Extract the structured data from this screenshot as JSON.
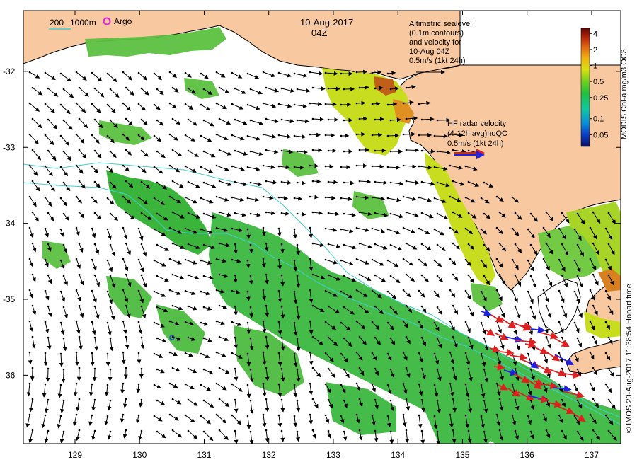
{
  "title": {
    "date": "10-Aug-2017",
    "time": "04Z"
  },
  "scale_legend": {
    "contour_200": "200",
    "contour_1000": "1000m",
    "argo_label": "Argo",
    "argo_color": "#e020e0",
    "contour_color": "#40d0d0"
  },
  "altimetry_note": {
    "line1": "Altimetric sealevel",
    "line2": "(0.1m contours)",
    "line3": "and velocity for",
    "line4": "10-Aug 04Z",
    "line5": "0.5m/s (1kt 24h)"
  },
  "hf_radar_note": {
    "line1": "HF radar velocity",
    "line2": "(4-12h avg)noQC",
    "line3": "0.5m/s (1kt 24h)",
    "arrow_colors": [
      "#e02020",
      "#2020e0"
    ]
  },
  "colorbar": {
    "title": "MODIS Chl-a mg/m3 OC3",
    "tick_labels": [
      "4",
      "2",
      "1",
      "0.5",
      "0.25",
      "0.1",
      "0.05"
    ],
    "tick_values": [
      4,
      2,
      1,
      0.5,
      0.25,
      0.1,
      0.05
    ],
    "range": [
      0.03,
      5
    ],
    "scale": "log",
    "colors": [
      "#08106a",
      "#0a3ec8",
      "#0a90d8",
      "#10c8a0",
      "#20c040",
      "#70d020",
      "#d8e010",
      "#f0b010",
      "#e06010",
      "#b02008",
      "#600808"
    ]
  },
  "axes": {
    "x_ticks": [
      "129",
      "130",
      "131",
      "132",
      "133",
      "134",
      "135",
      "136",
      "137"
    ],
    "x_values": [
      129,
      130,
      131,
      132,
      133,
      134,
      135,
      136,
      137
    ],
    "y_ticks": [
      "-32",
      "-33",
      "-34",
      "-35",
      "-36"
    ],
    "y_values": [
      -32,
      -33,
      -34,
      -35,
      -36
    ],
    "lon_range": [
      128.2,
      137.45
    ],
    "lat_range": [
      -36.9,
      -31.2
    ]
  },
  "credit": "© IMOS 20-Aug-2017 11:38:54 Hobart time",
  "colors": {
    "land": "#f8c8a0",
    "ocean": "#ffffff",
    "chl_green": "#30b030",
    "chl_yellow": "#c8dc20",
    "chl_orange": "#d08020"
  }
}
